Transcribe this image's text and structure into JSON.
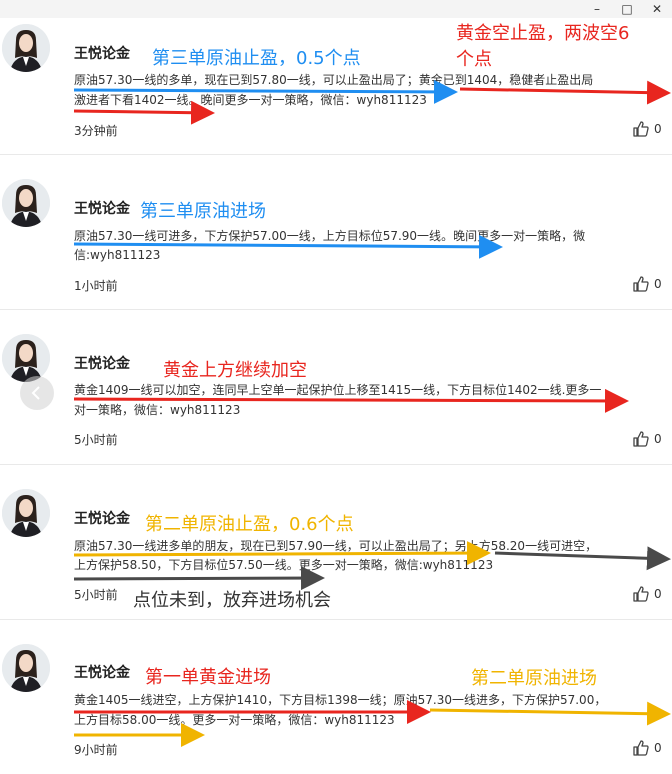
{
  "window": {
    "minimize_icon": "minimize-icon",
    "maximize_icon": "maximize-icon",
    "close_icon": "close-icon"
  },
  "posts": [
    {
      "author": "王悦论金",
      "line1": "原油57.30一线的多单，现在已到57.80一线，可以止盈出局了；黄金已到1404，稳健者止盈出局",
      "line2": "激进者下看1402一线。晚间更多一对一策略，微信：wyh811123",
      "time": "3分钟前",
      "likes": "0",
      "annotations": [
        "第三单原油止盈，0.5个点",
        "黄金空止盈，两波空6",
        "个点"
      ]
    },
    {
      "author": "王悦论金",
      "line1": "原油57.30一线可进多，下方保护57.00一线，上方目标位57.90一线。晚间更多一对一策略，微",
      "line2": "信:wyh811123",
      "time": "1小时前",
      "likes": "0",
      "annotations": [
        "第三单原油进场"
      ]
    },
    {
      "author": "王悦论金",
      "line1": "黄金1409一线可以加空，连同早上空单一起保护位上移至1415一线，下方目标位1402一线.更多一",
      "line2": "对一策略，微信：wyh811123",
      "time": "5小时前",
      "likes": "0",
      "annotations": [
        "黄金上方继续加空"
      ]
    },
    {
      "author": "王悦论金",
      "line1": "原油57.30一线进多单的朋友，现在已到57.90一线，可以止盈出局了；另上方58.20一线可进空，",
      "line2": "上方保护58.50，下方目标位57.50一线。更多一对一策略，微信:wyh811123",
      "time": "5小时前",
      "likes": "0",
      "annotations": [
        "第二单原油止盈，0.6个点",
        "点位未到，放弃进场机会"
      ]
    },
    {
      "author": "王悦论金",
      "line1": "黄金1405一线进空，上方保护1410，下方目标1398一线；原油57.30一线进多，下方保护57.00，",
      "line2": "上方目标58.00一线。更多一对一策略，微信：wyh811123",
      "time": "9小时前",
      "likes": "0",
      "annotations": [
        "第一单黄金进场",
        "第二单原油进场"
      ]
    }
  ],
  "colors": {
    "blue": "#1f8ef1",
    "red": "#e8261f",
    "yellow": "#f0b400",
    "dark": "#4a4a4a"
  },
  "icons": {
    "like": "thumbs-up-icon",
    "prev": "chevron-left-icon"
  }
}
